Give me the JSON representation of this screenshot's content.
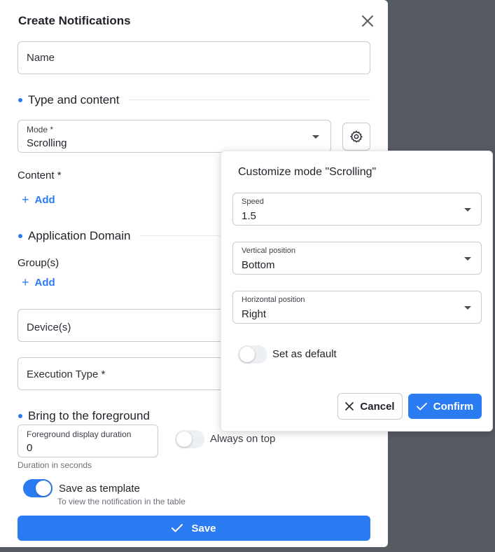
{
  "dialog": {
    "title": "Create Notifications",
    "name_placeholder": "Name",
    "type_section": "Type and content",
    "mode": {
      "label": "Mode *",
      "value": "Scrolling"
    },
    "content_label": "Content *",
    "add_label": "Add",
    "domain_section": "Application Domain",
    "groups_label": "Group(s)",
    "devices_placeholder": "Device(s)",
    "execution_placeholder": "Execution Type *",
    "foreground_section": "Bring to the foreground",
    "duration": {
      "label": "Foreground display duration",
      "value": "0"
    },
    "duration_hint": "Duration in seconds",
    "always_on_top": {
      "label": "Always on top",
      "on": false
    },
    "save_template": {
      "label": "Save as template",
      "hint": "To view the notification in the table",
      "on": true
    },
    "save_button": "Save"
  },
  "popover": {
    "title": "Customize mode \"Scrolling\"",
    "speed": {
      "label": "Speed",
      "value": "1.5"
    },
    "vertical": {
      "label": "Vertical position",
      "value": "Bottom"
    },
    "horizontal": {
      "label": "Horizontal position",
      "value": "Right"
    },
    "set_default": {
      "label": "Set as default",
      "on": false
    },
    "cancel_button": "Cancel",
    "confirm_button": "Confirm"
  },
  "colors": {
    "accent": "#2b7bf2",
    "backdrop": "#565b62"
  },
  "icons": {
    "close": "close-icon",
    "gear": "gear-icon",
    "check": "check-icon",
    "plus": "plus-icon"
  }
}
